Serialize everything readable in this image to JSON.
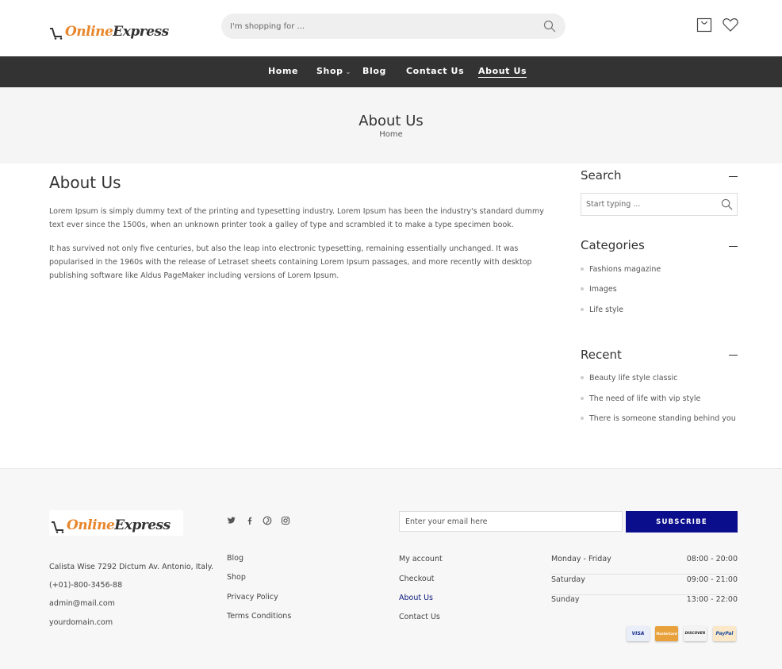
{
  "header": {
    "logo_word1": "Online",
    "logo_word2": "Express",
    "search_placeholder": "I'm shopping for ...",
    "icons": [
      "search-icon",
      "cart-icon",
      "heart-icon"
    ]
  },
  "nav": {
    "items": [
      {
        "label": "Home"
      },
      {
        "label": "Shop"
      },
      {
        "label": "Blog"
      },
      {
        "label": "Contact Us"
      },
      {
        "label": "About Us"
      }
    ],
    "shop_chevron": "⌄"
  },
  "banner": {
    "title": "About Us",
    "breadcrumb": "Home"
  },
  "main": {
    "title": "About Us",
    "paragraphs": [
      "Lorem Ipsum is simply dummy text of the printing and typesetting industry. Lorem Ipsum has been the industry's standard dummy text ever since the 1500s, when an unknown printer took a galley of type and scrambled it to make a type specimen book.",
      "It has survived not only five centuries, but also the leap into electronic typesetting, remaining essentially unchanged. It was popularised in the 1960s with the release of Letraset sheets containing Lorem Ipsum passages, and more recently with desktop publishing software like Aldus PageMaker including versions of Lorem Ipsum."
    ]
  },
  "sidebar": {
    "search_title": "Search",
    "search_placeholder": "Start typing ...",
    "categories_title": "Categories",
    "categories": [
      "Fashions magazine",
      "Images",
      "Life style"
    ],
    "recent_title": "Recent",
    "recent": [
      "Beauty life style classic",
      "The need of life with vip style",
      "There is someone standing behind you"
    ]
  },
  "footer": {
    "logo_word1": "Online",
    "logo_word2": "Express",
    "address": "Calista Wise 7292 Dictum Av. Antonio, Italy.",
    "phone": "(+01)-800-3456-88",
    "email": "admin@mail.com",
    "website": "yourdomain.com",
    "social_icons": [
      "twitter-icon",
      "facebook-icon",
      "pinterest-icon",
      "instagram-icon"
    ],
    "links1": [
      "Blog",
      "Shop",
      "Privacy Policy",
      "Terms Conditions"
    ],
    "links2": [
      "My account",
      "Checkout",
      "About Us",
      "Contact Us"
    ],
    "newsletter_placeholder": "Enter your email here",
    "subscribe_label": "SUBSCRIBE",
    "hours": [
      {
        "day": "Monday - Friday",
        "time": "08:00 - 20:00"
      },
      {
        "day": "Saturday",
        "time": "09:00 - 21:00"
      },
      {
        "day": "Sunday",
        "time": "13:00 - 22:00"
      }
    ],
    "payments": [
      "VISA",
      "MasterCard",
      "DISCOVER",
      "PayPal"
    ],
    "accent_color": "#0a0e8c"
  }
}
